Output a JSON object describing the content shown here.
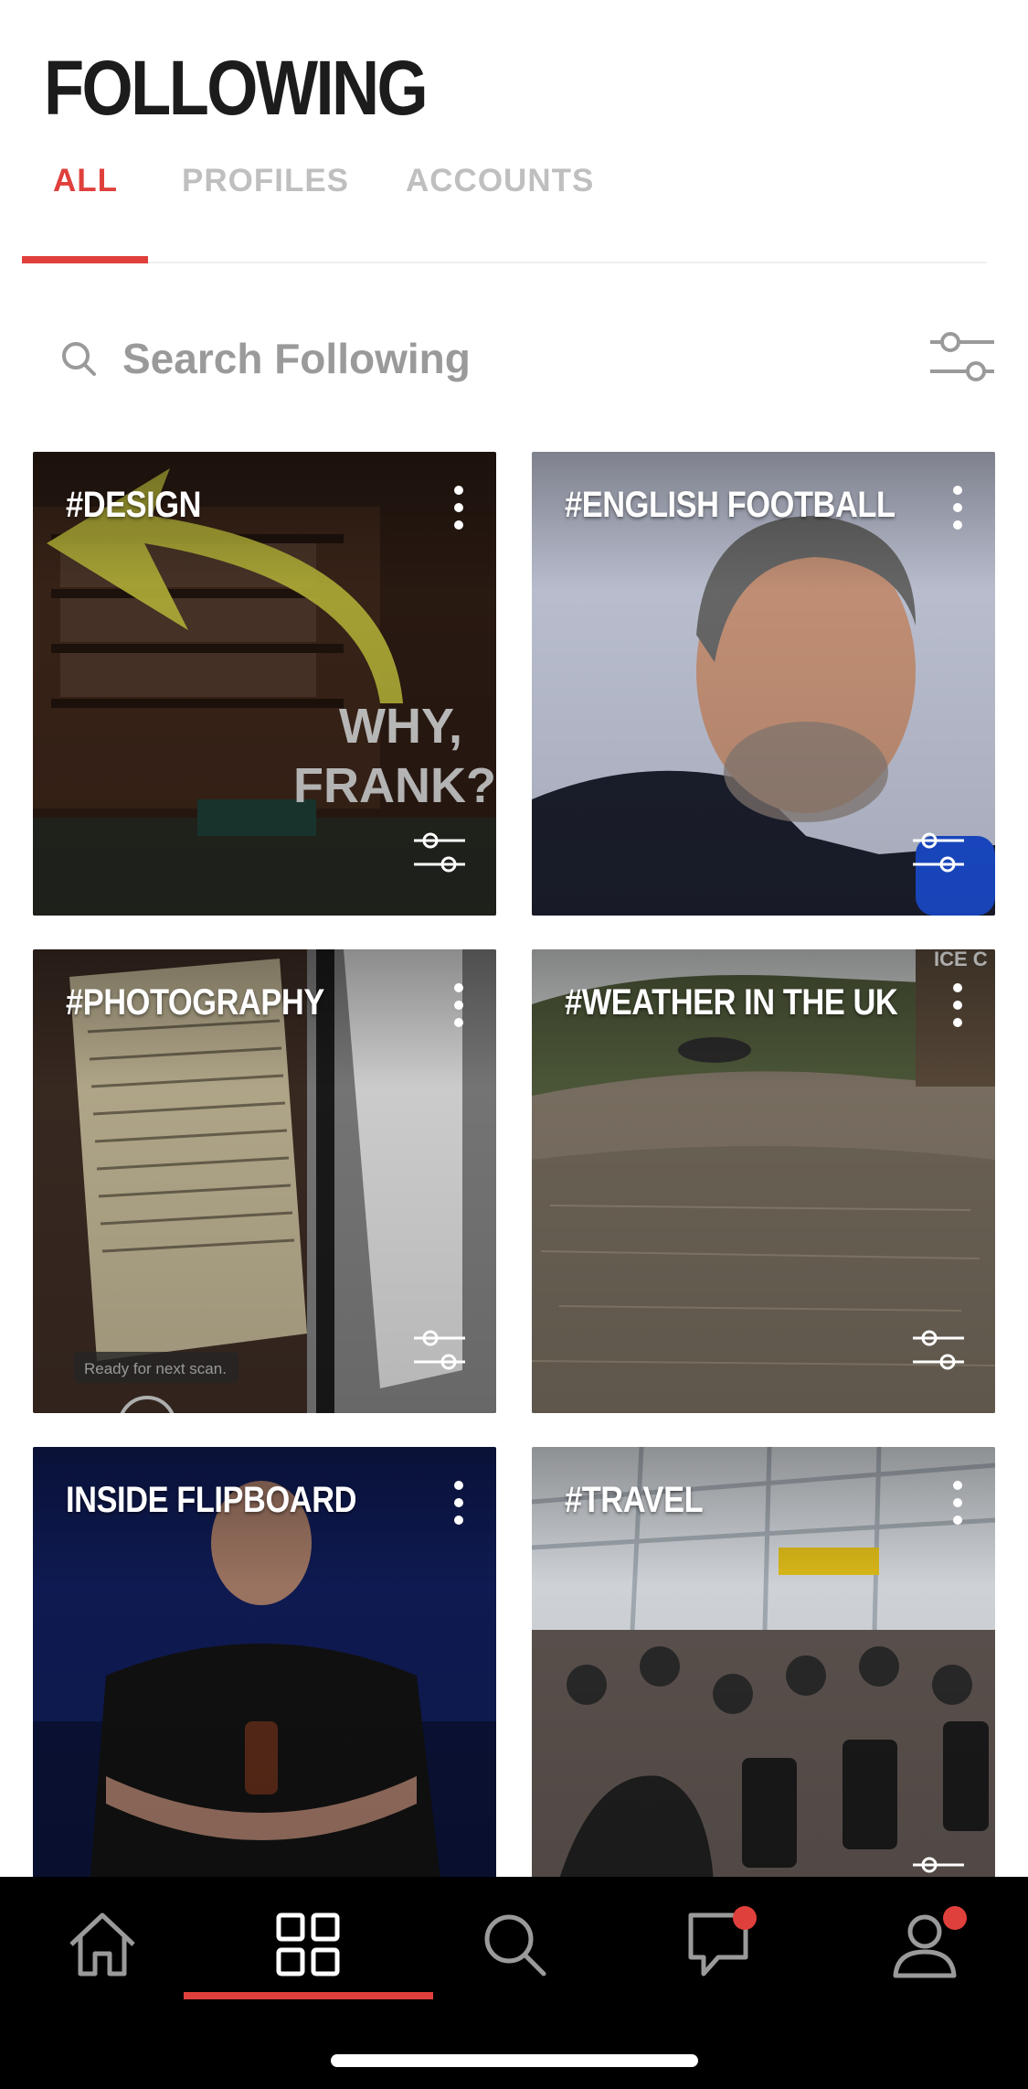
{
  "header": {
    "title": "FOLLOWING"
  },
  "tabs": [
    {
      "label": "ALL",
      "active": true
    },
    {
      "label": "PROFILES",
      "active": false
    },
    {
      "label": "ACCOUNTS",
      "active": false
    }
  ],
  "search": {
    "placeholder": "Search Following"
  },
  "tiles": [
    {
      "label": "#DESIGN",
      "overlay_text": "WHY,\nFRANK?"
    },
    {
      "label": "#ENGLISH FOOTBALL"
    },
    {
      "label": "#PHOTOGRAPHY",
      "overlay_text": "Ready for next scan."
    },
    {
      "label": "#WEATHER IN THE UK",
      "overlay_text": "ICE C"
    },
    {
      "label": "INSIDE FLIPBOARD"
    },
    {
      "label": "#TRAVEL"
    }
  ],
  "bottom_nav": [
    {
      "name": "home-icon",
      "active": false,
      "badge": false
    },
    {
      "name": "following-grid-icon",
      "active": true,
      "badge": false
    },
    {
      "name": "search-icon",
      "active": false,
      "badge": true
    },
    {
      "name": "messages-icon",
      "active": false,
      "badge": true
    },
    {
      "name": "profile-icon",
      "active": false,
      "badge": true
    }
  ],
  "colors": {
    "accent": "#e0403c",
    "nav_bg": "#000000",
    "inactive_tab": "#bfbfbf"
  }
}
